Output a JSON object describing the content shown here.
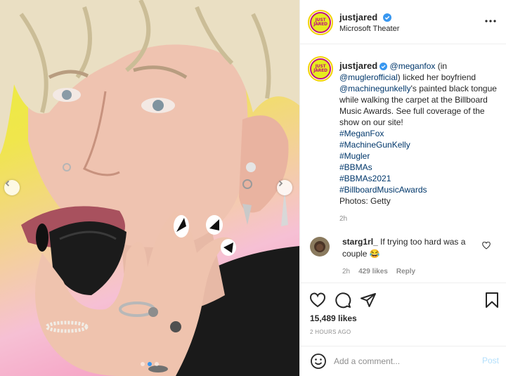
{
  "post": {
    "username": "justjared",
    "location": "Microsoft Theater",
    "avatar_text": "JUST\nJARED"
  },
  "caption": {
    "username": "justjared",
    "mention1": "@meganfox",
    "text1": " (in ",
    "mention2": "@muglerofficial",
    "text2": ") licked her boyfriend ",
    "mention3": "@machinegunkelly",
    "text3": "'s painted black tongue while walking the carpet at the Billboard Music Awards. See full coverage of the show on our site!",
    "hashtags": [
      "#MeganFox",
      "#MachineGunKelly",
      "#Mugler",
      "#BBMAs",
      "#BBMAs2021",
      "#BillboardMusicAwards"
    ],
    "credit": "Photos: Getty",
    "time": "2h"
  },
  "comment": {
    "username": "starg1rl_",
    "text": " If trying too hard was a couple 😂",
    "time": "2h",
    "likes": "429 likes",
    "reply": "Reply"
  },
  "stats": {
    "likes": "15,489 likes",
    "time_ago": "2 HOURS AGO"
  },
  "composer": {
    "placeholder": "Add a comment...",
    "post_label": "Post"
  },
  "carousel": {
    "slide_count": 3,
    "active_index": 1
  },
  "colors": {
    "link": "#00376b",
    "verified": "#3897f0",
    "post_disabled": "#b2dffc",
    "logo_yellow": "#e6ec1f",
    "logo_magenta": "#c0147a"
  },
  "icons": [
    "verified-icon",
    "more-icon",
    "chevron-left-icon",
    "chevron-right-icon",
    "heart-icon",
    "comment-icon",
    "share-icon",
    "bookmark-icon",
    "emoji-icon"
  ]
}
